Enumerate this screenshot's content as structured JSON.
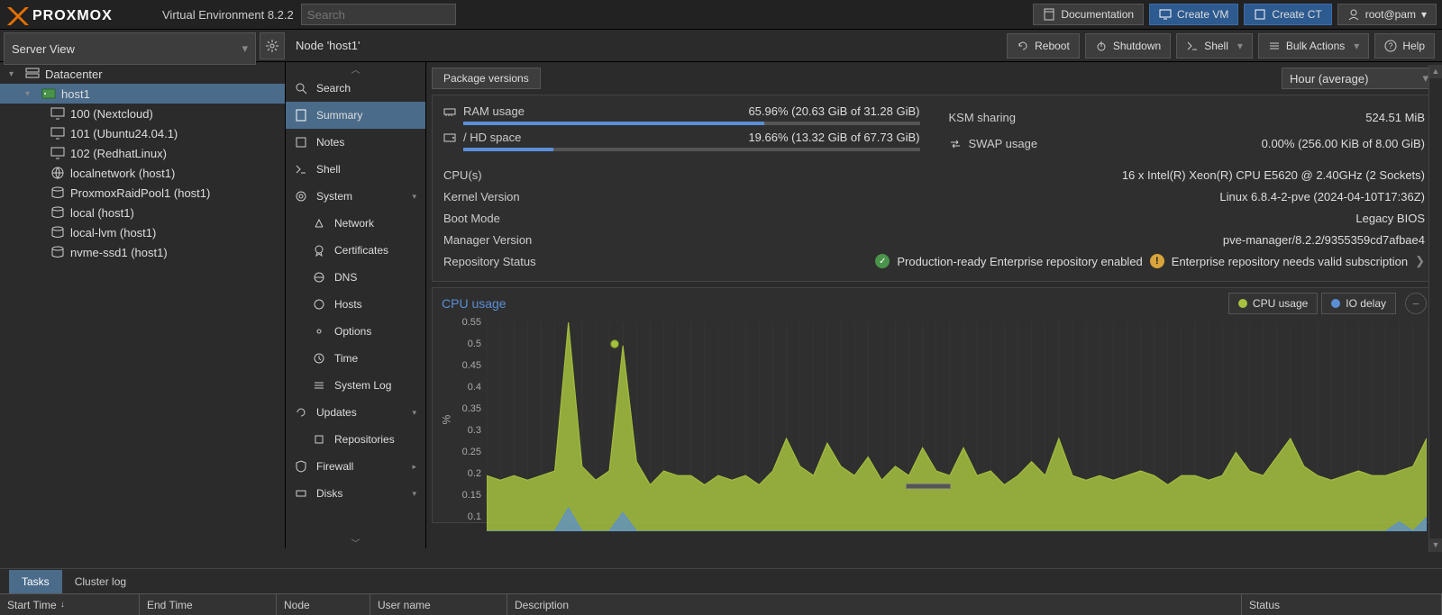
{
  "env_text": "Virtual Environment 8.2.2",
  "search_placeholder": "Search",
  "top_buttons": {
    "doc": "Documentation",
    "create_vm": "Create VM",
    "create_ct": "Create CT",
    "user": "root@pam"
  },
  "server_view_label": "Server View",
  "tree": {
    "root": "Datacenter",
    "host": "host1",
    "items": [
      "100 (Nextcloud)",
      "101 (Ubuntu24.04.1)",
      "102 (RedhatLinux)",
      "localnetwork (host1)",
      "ProxmoxRaidPool1 (host1)",
      "local (host1)",
      "local-lvm (host1)",
      "nvme-ssd1 (host1)"
    ]
  },
  "node_title": "Node 'host1'",
  "actions": {
    "reboot": "Reboot",
    "shutdown": "Shutdown",
    "shell": "Shell",
    "bulk": "Bulk Actions",
    "help": "Help"
  },
  "nav": {
    "search": "Search",
    "summary": "Summary",
    "notes": "Notes",
    "shell": "Shell",
    "system": "System",
    "network": "Network",
    "certificates": "Certificates",
    "dns": "DNS",
    "hosts": "Hosts",
    "options": "Options",
    "time": "Time",
    "syslog": "System Log",
    "updates": "Updates",
    "repositories": "Repositories",
    "firewall": "Firewall",
    "disks": "Disks"
  },
  "pkg_versions": "Package versions",
  "time_select": "Hour (average)",
  "usage": {
    "ram_label": "RAM usage",
    "ram_value": "65.96% (20.63 GiB of 31.28 GiB)",
    "ram_pct": 65.96,
    "hd_label": "/ HD space",
    "hd_value": "19.66% (13.32 GiB of 67.73 GiB)",
    "hd_pct": 19.66,
    "ksm_label": "KSM sharing",
    "ksm_value": "524.51 MiB",
    "swap_label": "SWAP usage",
    "swap_value": "0.00% (256.00 KiB of 8.00 GiB)"
  },
  "details": {
    "cpus_label": "CPU(s)",
    "cpus_value": "16 x Intel(R) Xeon(R) CPU E5620 @ 2.40GHz (2 Sockets)",
    "kernel_label": "Kernel Version",
    "kernel_value": "Linux 6.8.4-2-pve (2024-04-10T17:36Z)",
    "boot_label": "Boot Mode",
    "boot_value": "Legacy BIOS",
    "mgr_label": "Manager Version",
    "mgr_value": "pve-manager/8.2.2/9355359cd7afbae4",
    "repo_label": "Repository Status",
    "repo_ok": "Production-ready Enterprise repository enabled",
    "repo_warn": "Enterprise repository needs valid subscription"
  },
  "chart": {
    "title": "CPU usage",
    "legend_cpu": "CPU usage",
    "legend_io": "IO delay",
    "ylabel": "%",
    "y_ticks": [
      "0.55",
      "0.5",
      "0.45",
      "0.4",
      "0.35",
      "0.3",
      "0.25",
      "0.2",
      "0.15",
      "0.1"
    ]
  },
  "chart_data": {
    "type": "area",
    "title": "CPU usage",
    "ylabel": "%",
    "ylim": [
      0.1,
      0.55
    ],
    "series": [
      {
        "name": "CPU usage",
        "color": "#a5c13e",
        "values": [
          0.22,
          0.21,
          0.22,
          0.21,
          0.22,
          0.23,
          0.55,
          0.24,
          0.21,
          0.23,
          0.5,
          0.25,
          0.2,
          0.23,
          0.22,
          0.22,
          0.2,
          0.22,
          0.21,
          0.22,
          0.2,
          0.23,
          0.3,
          0.24,
          0.22,
          0.29,
          0.24,
          0.22,
          0.26,
          0.21,
          0.24,
          0.22,
          0.28,
          0.23,
          0.22,
          0.28,
          0.22,
          0.23,
          0.2,
          0.22,
          0.25,
          0.22,
          0.3,
          0.22,
          0.21,
          0.22,
          0.21,
          0.22,
          0.23,
          0.22,
          0.2,
          0.22,
          0.22,
          0.21,
          0.22,
          0.27,
          0.23,
          0.22,
          0.26,
          0.3,
          0.24,
          0.22,
          0.21,
          0.22,
          0.23,
          0.22,
          0.22,
          0.23,
          0.24,
          0.3
        ]
      },
      {
        "name": "IO delay",
        "color": "#5a8fd6",
        "values": [
          0.1,
          0.1,
          0.1,
          0.1,
          0.1,
          0.1,
          0.15,
          0.1,
          0.1,
          0.1,
          0.14,
          0.1,
          0.1,
          0.1,
          0.1,
          0.1,
          0.1,
          0.1,
          0.1,
          0.1,
          0.1,
          0.1,
          0.1,
          0.1,
          0.1,
          0.1,
          0.1,
          0.1,
          0.1,
          0.1,
          0.1,
          0.1,
          0.1,
          0.1,
          0.1,
          0.1,
          0.1,
          0.1,
          0.1,
          0.1,
          0.1,
          0.1,
          0.1,
          0.1,
          0.1,
          0.1,
          0.1,
          0.1,
          0.1,
          0.1,
          0.1,
          0.1,
          0.1,
          0.1,
          0.1,
          0.1,
          0.1,
          0.1,
          0.1,
          0.1,
          0.1,
          0.1,
          0.1,
          0.1,
          0.1,
          0.1,
          0.1,
          0.12,
          0.1,
          0.13
        ]
      }
    ]
  },
  "bottom_tabs": {
    "tasks": "Tasks",
    "cluster": "Cluster log"
  },
  "grid_headers": {
    "start": "Start Time",
    "end": "End Time",
    "node": "Node",
    "user": "User name",
    "desc": "Description",
    "status": "Status"
  }
}
